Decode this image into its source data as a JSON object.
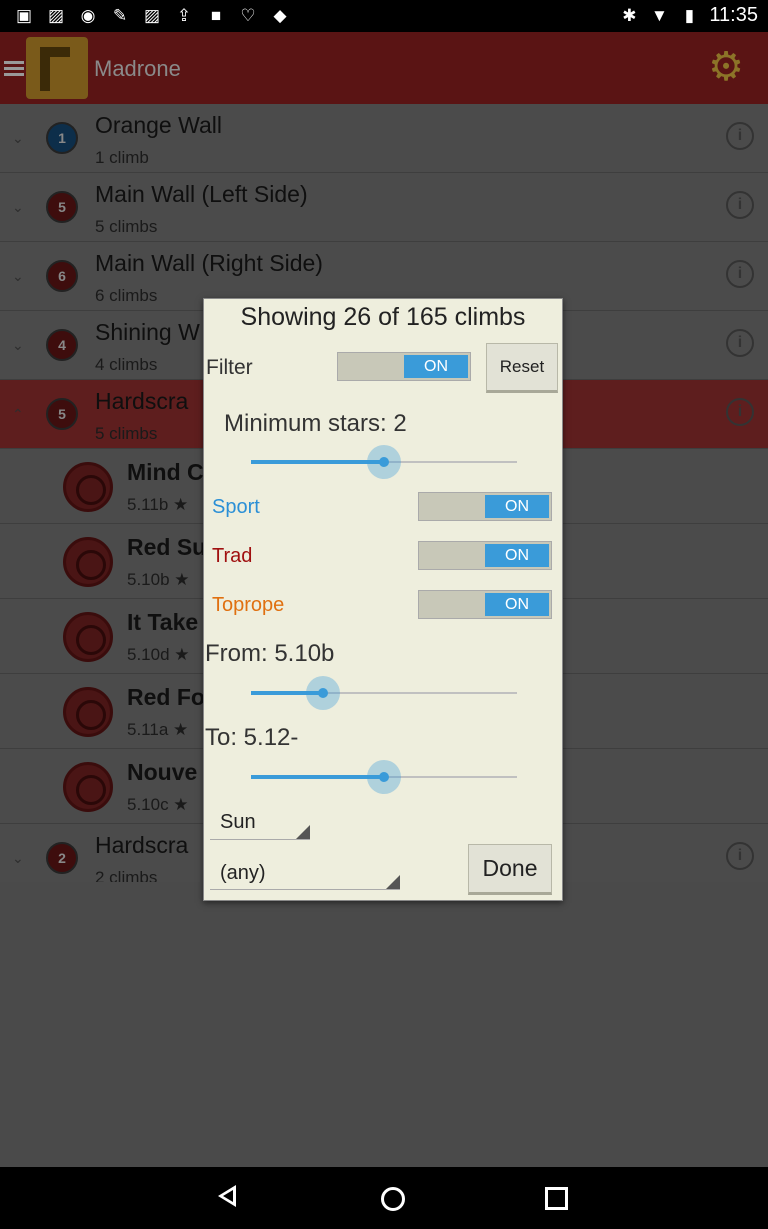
{
  "status_bar": {
    "time": "11:35",
    "left_icons": [
      "chat-icon",
      "image-icon",
      "messenger-icon",
      "wrench-icon",
      "image-icon",
      "upload-icon",
      "square-icon",
      "heart-icon",
      "tag-icon"
    ],
    "right_icons": [
      "bluetooth-icon",
      "wifi-icon",
      "battery-icon"
    ]
  },
  "app_bar": {
    "title": "Madrone"
  },
  "areas": [
    {
      "badge": "1",
      "name": "Orange Wall",
      "count": "1 climb"
    },
    {
      "badge": "5",
      "name": "Main Wall (Left Side)",
      "count": "5 climbs"
    },
    {
      "badge": "6",
      "name": "Main Wall (Right Side)",
      "count": "6 climbs"
    },
    {
      "badge": "4",
      "name": "Shining W",
      "count": "4 climbs"
    },
    {
      "badge": "5",
      "name": "Hardscra",
      "count": "5 climbs"
    }
  ],
  "routes": [
    {
      "name": "Mind C",
      "grade": "5.11b ★"
    },
    {
      "name": "Red Su",
      "grade": "5.10b ★"
    },
    {
      "name": "It Take",
      "grade": "5.10d ★"
    },
    {
      "name": "Red Fo",
      "grade": "5.11a ★"
    },
    {
      "name": "Nouve",
      "grade": "5.10c ★"
    }
  ],
  "last_area": {
    "badge": "2",
    "name": "Hardscra",
    "count": "2 climbs"
  },
  "dialog": {
    "heading": "Showing 26 of 165 climbs",
    "filter_label": "Filter",
    "filter_toggle": "ON",
    "reset_label": "Reset",
    "min_stars_label": "Minimum stars: 2",
    "min_stars_fraction": 0.5,
    "sport_label": "Sport",
    "sport_toggle": "ON",
    "trad_label": "Trad",
    "trad_toggle": "ON",
    "toprope_label": "Toprope",
    "toprope_toggle": "ON",
    "from_label": "From: 5.10b",
    "from_fraction": 0.27,
    "to_label": "To: 5.12-",
    "to_fraction": 0.5,
    "sun_value": "Sun",
    "any_value": "(any)",
    "done_label": "Done"
  },
  "colors": {
    "accent": "#3a9bd9",
    "sport": "#2a8fd6",
    "trad": "#a01010",
    "toprope": "#e07010",
    "appbar": "#5a1414"
  }
}
